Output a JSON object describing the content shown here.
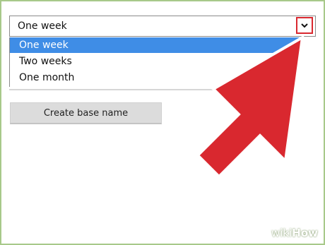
{
  "select": {
    "value": "One week",
    "arrow_icon": "chevron-down-icon",
    "arrow_glyph": "⌄",
    "highlight_color": "#d9282f"
  },
  "dropdown": {
    "options": [
      {
        "label": "One week",
        "selected": true
      },
      {
        "label": "Two weeks",
        "selected": false
      },
      {
        "label": "One month",
        "selected": false
      }
    ],
    "selected_color": "#3f8de6"
  },
  "button": {
    "label": "Create base name"
  },
  "overlay": {
    "arrow_color": "#d9282f",
    "arrow_icon": "pointer-arrow-icon"
  },
  "brand": {
    "part1": "wiki",
    "part2": "How"
  }
}
